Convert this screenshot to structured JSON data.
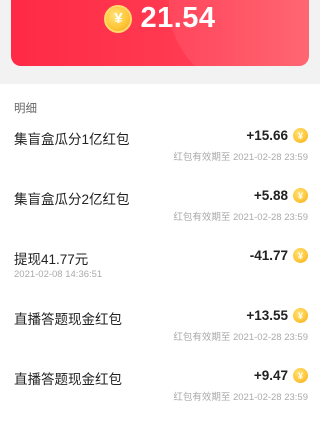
{
  "balance": {
    "amount": "21.54",
    "icon": "yen-coin-icon",
    "currency_glyph": "¥"
  },
  "section": {
    "title": "明细"
  },
  "transactions": [
    {
      "title": "集盲盒瓜分1亿红包",
      "amount": "+15.66",
      "meta": "红包有效期至 2021-02-28 23:59",
      "meta_align": "right"
    },
    {
      "title": "集盲盒瓜分2亿红包",
      "amount": "+5.88",
      "meta": "红包有效期至 2021-02-28 23:59",
      "meta_align": "right"
    },
    {
      "title": "提现41.77元",
      "amount": "-41.77",
      "meta": "2021-02-08 14:36:51",
      "meta_align": "left"
    },
    {
      "title": "直播答题现金红包",
      "amount": "+13.55",
      "meta": "红包有效期至 2021-02-28 23:59",
      "meta_align": "right"
    },
    {
      "title": "直播答题现金红包",
      "amount": "+9.47",
      "meta": "红包有效期至 2021-02-28 23:59",
      "meta_align": "right"
    }
  ],
  "colors": {
    "accent": "#ff2a45",
    "coin": "#ffc83a"
  }
}
